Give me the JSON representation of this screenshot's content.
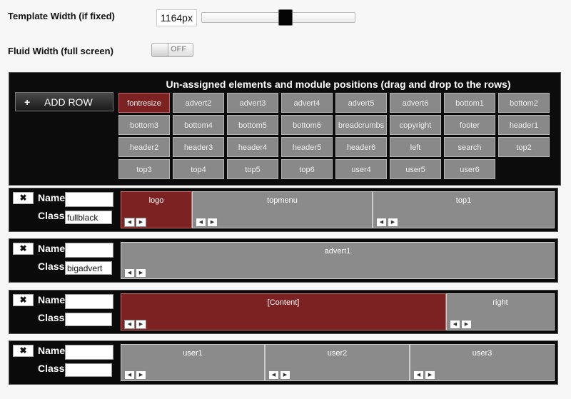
{
  "settings": {
    "template_width_label": "Template Width (if fixed)",
    "template_width_value": "1164px",
    "slider_level_fraction": 0.5,
    "fluid_width_label": "Fluid Width (full screen)",
    "fluid_toggle_label": "OFF"
  },
  "unassigned": {
    "title": "Un-assigned elements and module positions (drag and drop to the rows)",
    "add_row_icon": "plus-icon",
    "add_row_label": "ADD ROW",
    "chips": [
      {
        "label": "fontresize",
        "highlight": true
      },
      {
        "label": "advert2"
      },
      {
        "label": "advert3"
      },
      {
        "label": "advert4"
      },
      {
        "label": "advert5"
      },
      {
        "label": "advert6"
      },
      {
        "label": "bottom1"
      },
      {
        "label": "bottom2"
      },
      {
        "label": "bottom3"
      },
      {
        "label": "bottom4"
      },
      {
        "label": "bottom5"
      },
      {
        "label": "bottom6"
      },
      {
        "label": "breadcrumbs"
      },
      {
        "label": "copyright"
      },
      {
        "label": "footer"
      },
      {
        "label": "header1"
      },
      {
        "label": "header2"
      },
      {
        "label": "header3"
      },
      {
        "label": "header4"
      },
      {
        "label": "header5"
      },
      {
        "label": "header6"
      },
      {
        "label": "left"
      },
      {
        "label": "search"
      },
      {
        "label": "top2"
      },
      {
        "label": "top3"
      },
      {
        "label": "top4"
      },
      {
        "label": "top5"
      },
      {
        "label": "top6"
      },
      {
        "label": "user4"
      },
      {
        "label": "user5"
      },
      {
        "label": "user6"
      }
    ]
  },
  "rows": [
    {
      "name_label": "Name",
      "class_label": "Class",
      "name_value": "",
      "class_value": "fullblack",
      "modules": [
        {
          "label": "logo",
          "highlight": true
        },
        {
          "label": "topmenu"
        },
        {
          "label": "top1"
        }
      ]
    },
    {
      "name_label": "Name",
      "class_label": "Class",
      "name_value": "",
      "class_value": "bigadvert",
      "modules": [
        {
          "label": "advert1"
        }
      ]
    },
    {
      "name_label": "Name",
      "class_label": "Class",
      "name_value": "",
      "class_value": "",
      "modules": [
        {
          "label": "[Content]",
          "highlight": true
        },
        {
          "label": "right"
        }
      ]
    },
    {
      "name_label": "Name",
      "class_label": "Class",
      "name_value": "",
      "class_value": "",
      "modules": [
        {
          "label": "user1"
        },
        {
          "label": "user2"
        },
        {
          "label": "user3"
        }
      ]
    }
  ],
  "icons": {
    "remove": "close-icon",
    "move_left": "arrow-left-icon",
    "move_right": "arrow-right-icon"
  },
  "colors": {
    "highlight": "#7d2222",
    "module": "#8b8b8b",
    "panel": "#0c0c0c"
  }
}
